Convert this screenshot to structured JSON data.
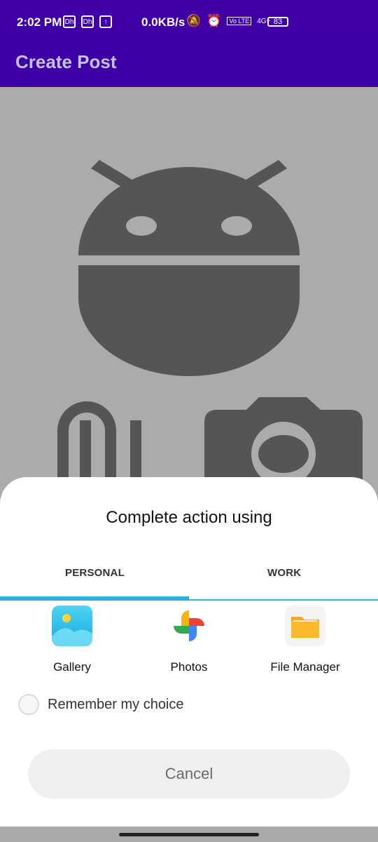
{
  "status_bar": {
    "time": "2:02 PM",
    "net_speed": "0.0KB/s",
    "battery": "83",
    "icons": [
      "dh-icon",
      "dh-icon",
      "upload-arrow-icon",
      "mute-icon",
      "alarm-icon",
      "volte-icon",
      "signal-4g-icon"
    ],
    "network_label": "4G+",
    "volte_label": "Vo LTE"
  },
  "app_bar": {
    "title": "Create Post"
  },
  "sheet": {
    "title": "Complete action using",
    "tabs": [
      {
        "label": "PERSONAL",
        "selected": true
      },
      {
        "label": "WORK",
        "selected": false
      }
    ],
    "apps": [
      {
        "label": "Gallery",
        "icon": "gallery-icon"
      },
      {
        "label": "Photos",
        "icon": "google-photos-icon"
      },
      {
        "label": "File Manager",
        "icon": "file-manager-icon"
      }
    ],
    "remember_label": "Remember my choice",
    "cancel_label": "Cancel"
  },
  "colors": {
    "accent": "#3d00a7",
    "tab_indicator": "#23b3e5",
    "background": "#ababab",
    "illustration": "#555555"
  }
}
